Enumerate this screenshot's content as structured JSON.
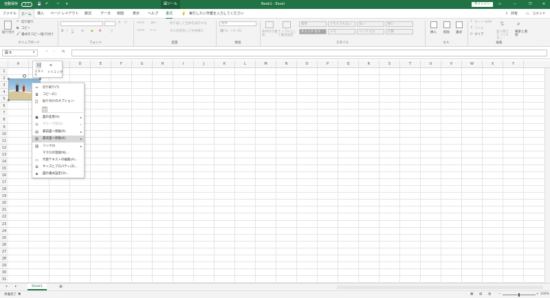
{
  "titlebar": {
    "autosave": "自動保存",
    "autosave_state": "オフ",
    "context_tab": "図ツール",
    "title": "Book1 - Excel",
    "signin": "サインイン"
  },
  "tabs": [
    "ファイル",
    "ホーム",
    "挿入",
    "ページ レイアウト",
    "数式",
    "データ",
    "校閲",
    "表示",
    "ヘルプ",
    "書式"
  ],
  "search_placeholder": "実行したい作業を入力してください",
  "share": "共有",
  "comment": "コメント",
  "ribbon": {
    "clipboard": {
      "paste": "貼り付け",
      "cut": "切り取り",
      "copy": "コピー",
      "format_painter": "書式のコピー/貼り付け",
      "label": "クリップボード"
    },
    "font": {
      "label": "フォント"
    },
    "alignment": {
      "wrap": "折り返して全体を表示する",
      "merge": "セルを結合して中央揃え",
      "label": "配置"
    },
    "number": {
      "format": "標準",
      "label": "数値"
    },
    "styles": {
      "cond": "条件付き書式",
      "table": "テーブルとして書式設定",
      "s1": "標準",
      "s2": "どちらでもない",
      "s3": "良い",
      "s4": "悪い",
      "s5": "チェック セル",
      "s6": "メモ",
      "s7": "リンク セル",
      "s8": "計算",
      "label": "スタイル"
    },
    "cells": {
      "insert": "挿入",
      "delete": "削除",
      "format": "書式",
      "label": "セル"
    },
    "editing": {
      "autosum": "オート SUM",
      "fill": "フィル",
      "clear": "クリア",
      "sort": "並べ替えとフィルター",
      "find": "検索と選択",
      "label": "編集"
    }
  },
  "namebox": "図 6",
  "columns": [
    "A",
    "B",
    "C",
    "D",
    "E",
    "F",
    "G",
    "H",
    "I",
    "J",
    "K",
    "L",
    "M",
    "N",
    "O",
    "P",
    "Q",
    "R",
    "S",
    "T",
    "U",
    "V",
    "W",
    "X",
    "Y"
  ],
  "rows": [
    "1",
    "2",
    "3",
    "4",
    "5",
    "6",
    "7",
    "8",
    "9",
    "10",
    "11",
    "12",
    "13",
    "14",
    "15",
    "16",
    "17",
    "18",
    "19",
    "20",
    "21",
    "22",
    "23",
    "24",
    "25",
    "26",
    "27",
    "28",
    "29",
    "30",
    "31"
  ],
  "mini_toolbar": {
    "style": "スタイル",
    "crop": "トリミング"
  },
  "context_menu": [
    {
      "label": "切り取り(T)",
      "icon": "✂"
    },
    {
      "label": "コピー(C)",
      "icon": "⧉"
    },
    {
      "label": "貼り付けのオプション:",
      "icon": "📋"
    },
    {
      "label": "",
      "icon": "📋"
    },
    {
      "label": "図の変更(A)",
      "icon": "▣",
      "arrow": "▸"
    },
    {
      "label": "グループ化(G)",
      "icon": "▦",
      "arrow": "▸",
      "disabled": true
    },
    {
      "label": "最前面へ移動(R)",
      "icon": "▤",
      "arrow": "▸"
    },
    {
      "label": "最背面へ移動(K)",
      "icon": "▥",
      "arrow": "▸",
      "highlighted": true
    },
    {
      "label": "リンク(I)",
      "icon": "⛓",
      "arrow": "▸"
    },
    {
      "label": "マクロの登録(N)...",
      "icon": ""
    },
    {
      "label": "代替テキストの編集(A)...",
      "icon": "▭"
    },
    {
      "label": "サイズとプロパティ(Z)...",
      "icon": "⊞"
    },
    {
      "label": "図の書式設定(O)...",
      "icon": "◈"
    }
  ],
  "sheet": {
    "name": "Sheet1"
  },
  "status": {
    "ready": "準備完了",
    "zoom": "100%"
  },
  "colors": {
    "brand": "#217346",
    "highlight": "#d8d8d8"
  }
}
